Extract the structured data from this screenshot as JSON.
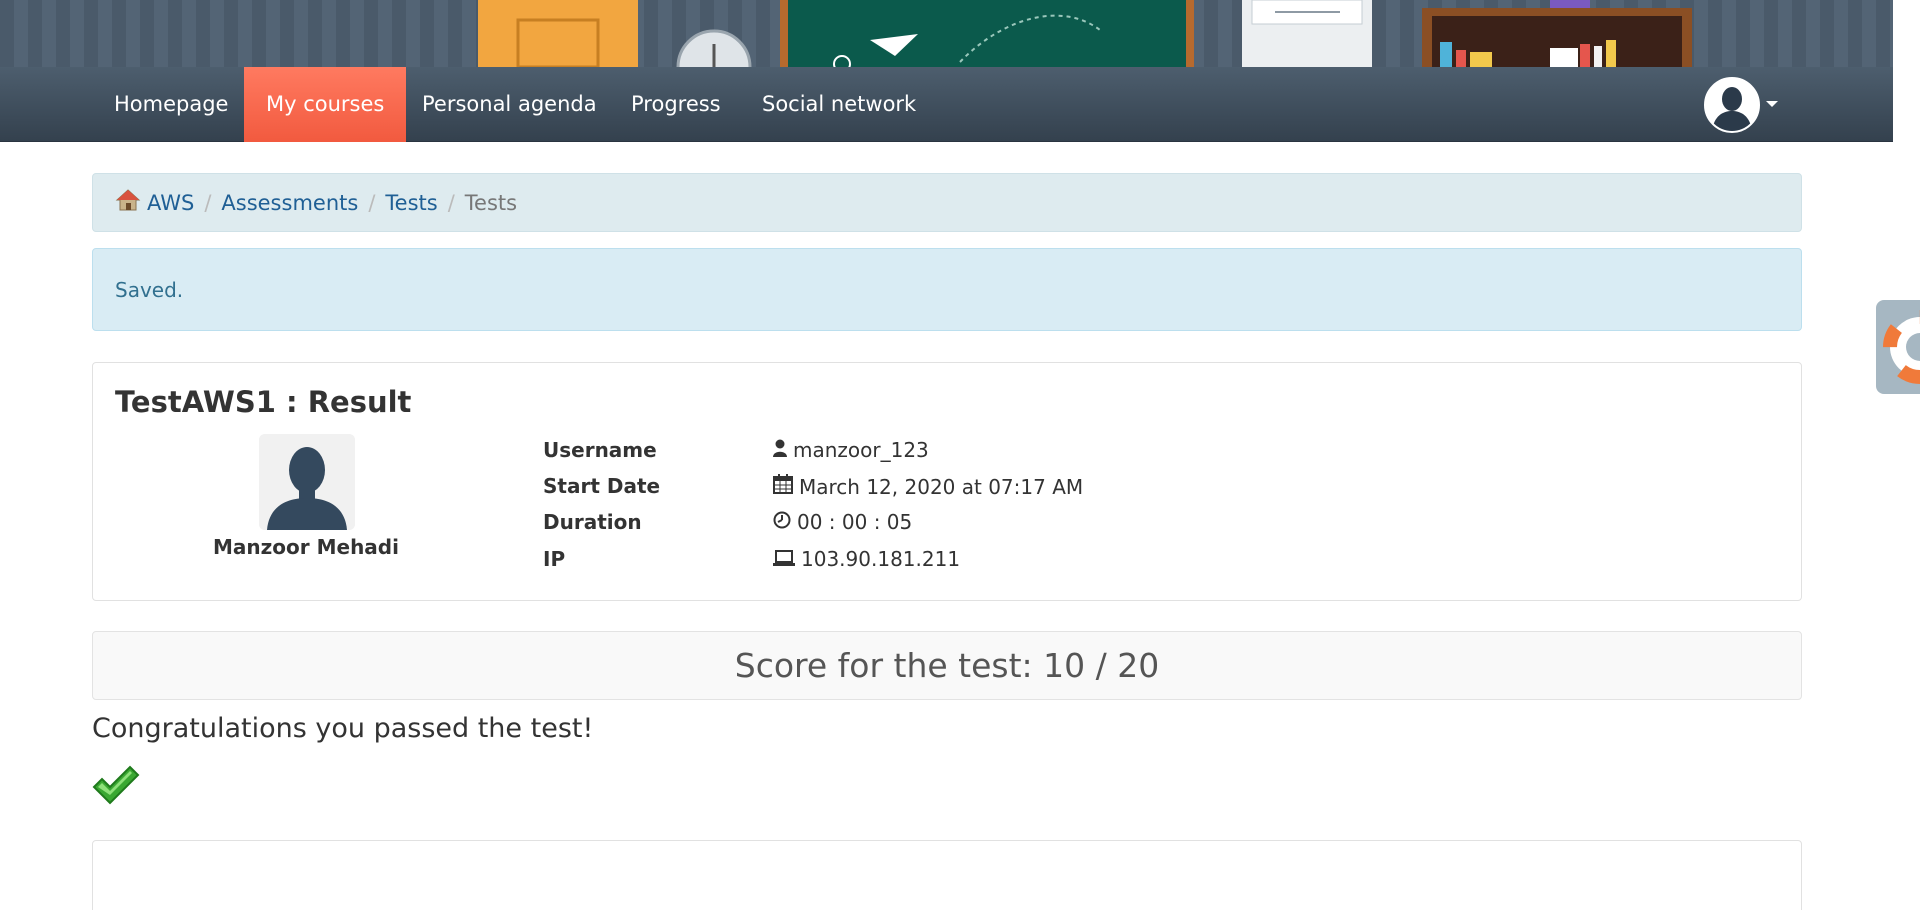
{
  "nav": {
    "items": [
      {
        "label": "Homepage"
      },
      {
        "label": "My courses",
        "active": true
      },
      {
        "label": "Personal agenda"
      },
      {
        "label": "Progress"
      },
      {
        "label": "Social network"
      }
    ]
  },
  "breadcrumb": {
    "items": [
      "AWS",
      "Assessments",
      "Tests",
      "Tests"
    ]
  },
  "alert": {
    "message": "Saved."
  },
  "result": {
    "title": "TestAWS1 : Result",
    "user_full_name": "Manzoor Mehadi",
    "fields": [
      {
        "label": "Username",
        "value": "manzoor_123",
        "icon": "user-icon"
      },
      {
        "label": "Start Date",
        "value": "March 12, 2020 at 07:17 AM",
        "icon": "calendar-icon"
      },
      {
        "label": "Duration",
        "value": "00 : 00 : 05",
        "icon": "clock-icon"
      },
      {
        "label": "IP",
        "value": "103.90.181.211",
        "icon": "laptop-icon"
      }
    ]
  },
  "score": {
    "text": "Score for the test: 10 / 20"
  },
  "feedback": {
    "message": "Congratulations you passed the test!"
  },
  "colors": {
    "nav_active": "#f25a3f",
    "nav_bg": "#3f4d5b",
    "link": "#1f5f95",
    "alert_bg": "#d9ecf4",
    "success": "#3aa832"
  }
}
